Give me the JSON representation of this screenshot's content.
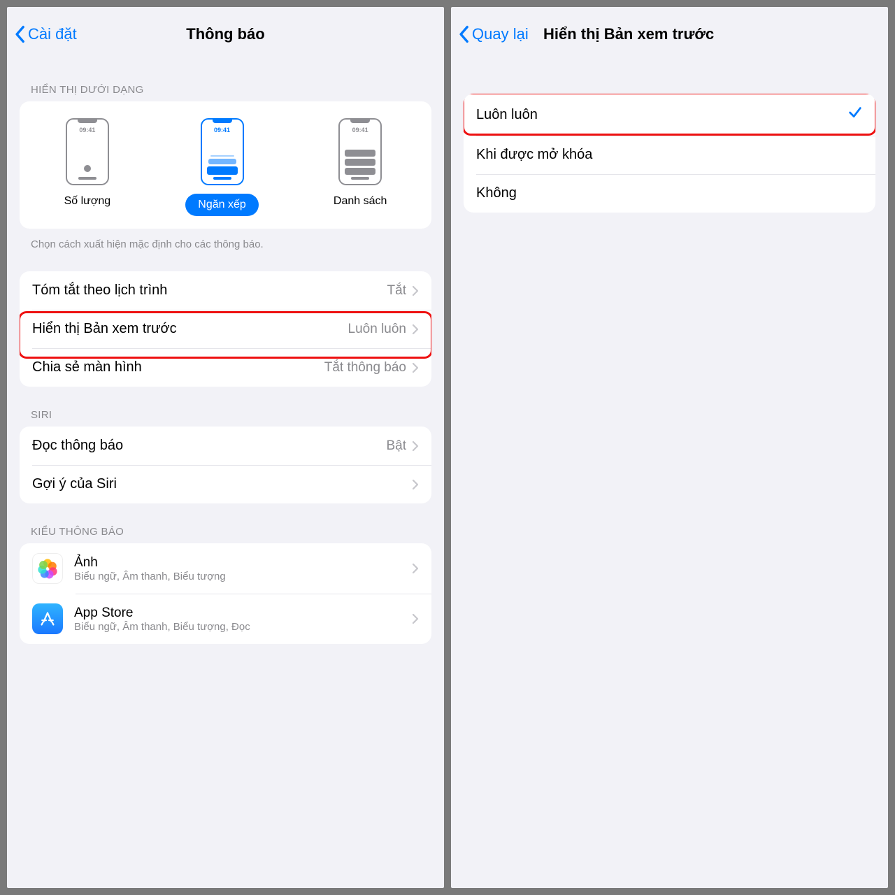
{
  "left": {
    "back": "Cài đặt",
    "title": "Thông báo",
    "display_header": "HIỂN THỊ DƯỚI DẠNG",
    "phone_time": "09:41",
    "opt_count": "Số lượng",
    "opt_stack": "Ngăn xếp",
    "opt_list": "Danh sách",
    "display_footer": "Chọn cách xuất hiện mặc định cho các thông báo.",
    "row_summary": "Tóm tắt theo lịch trình",
    "row_summary_val": "Tắt",
    "row_preview": "Hiển thị Bản xem trước",
    "row_preview_val": "Luôn luôn",
    "row_screenshare": "Chia sẻ màn hình",
    "row_screenshare_val": "Tắt thông báo",
    "siri_header": "SIRI",
    "row_announce": "Đọc thông báo",
    "row_announce_val": "Bật",
    "row_sirisuggest": "Gợi ý của Siri",
    "style_header": "KIỂU THÔNG BÁO",
    "app_photos": "Ảnh",
    "app_photos_sub": "Biểu ngữ, Âm thanh, Biểu tượng",
    "app_store": "App Store",
    "app_store_sub": "Biểu ngữ, Âm thanh, Biểu tượng, Đọc"
  },
  "right": {
    "back": "Quay lại",
    "title": "Hiển thị Bản xem trước",
    "opt_always": "Luôn luôn",
    "opt_unlocked": "Khi được mở khóa",
    "opt_never": "Không"
  }
}
